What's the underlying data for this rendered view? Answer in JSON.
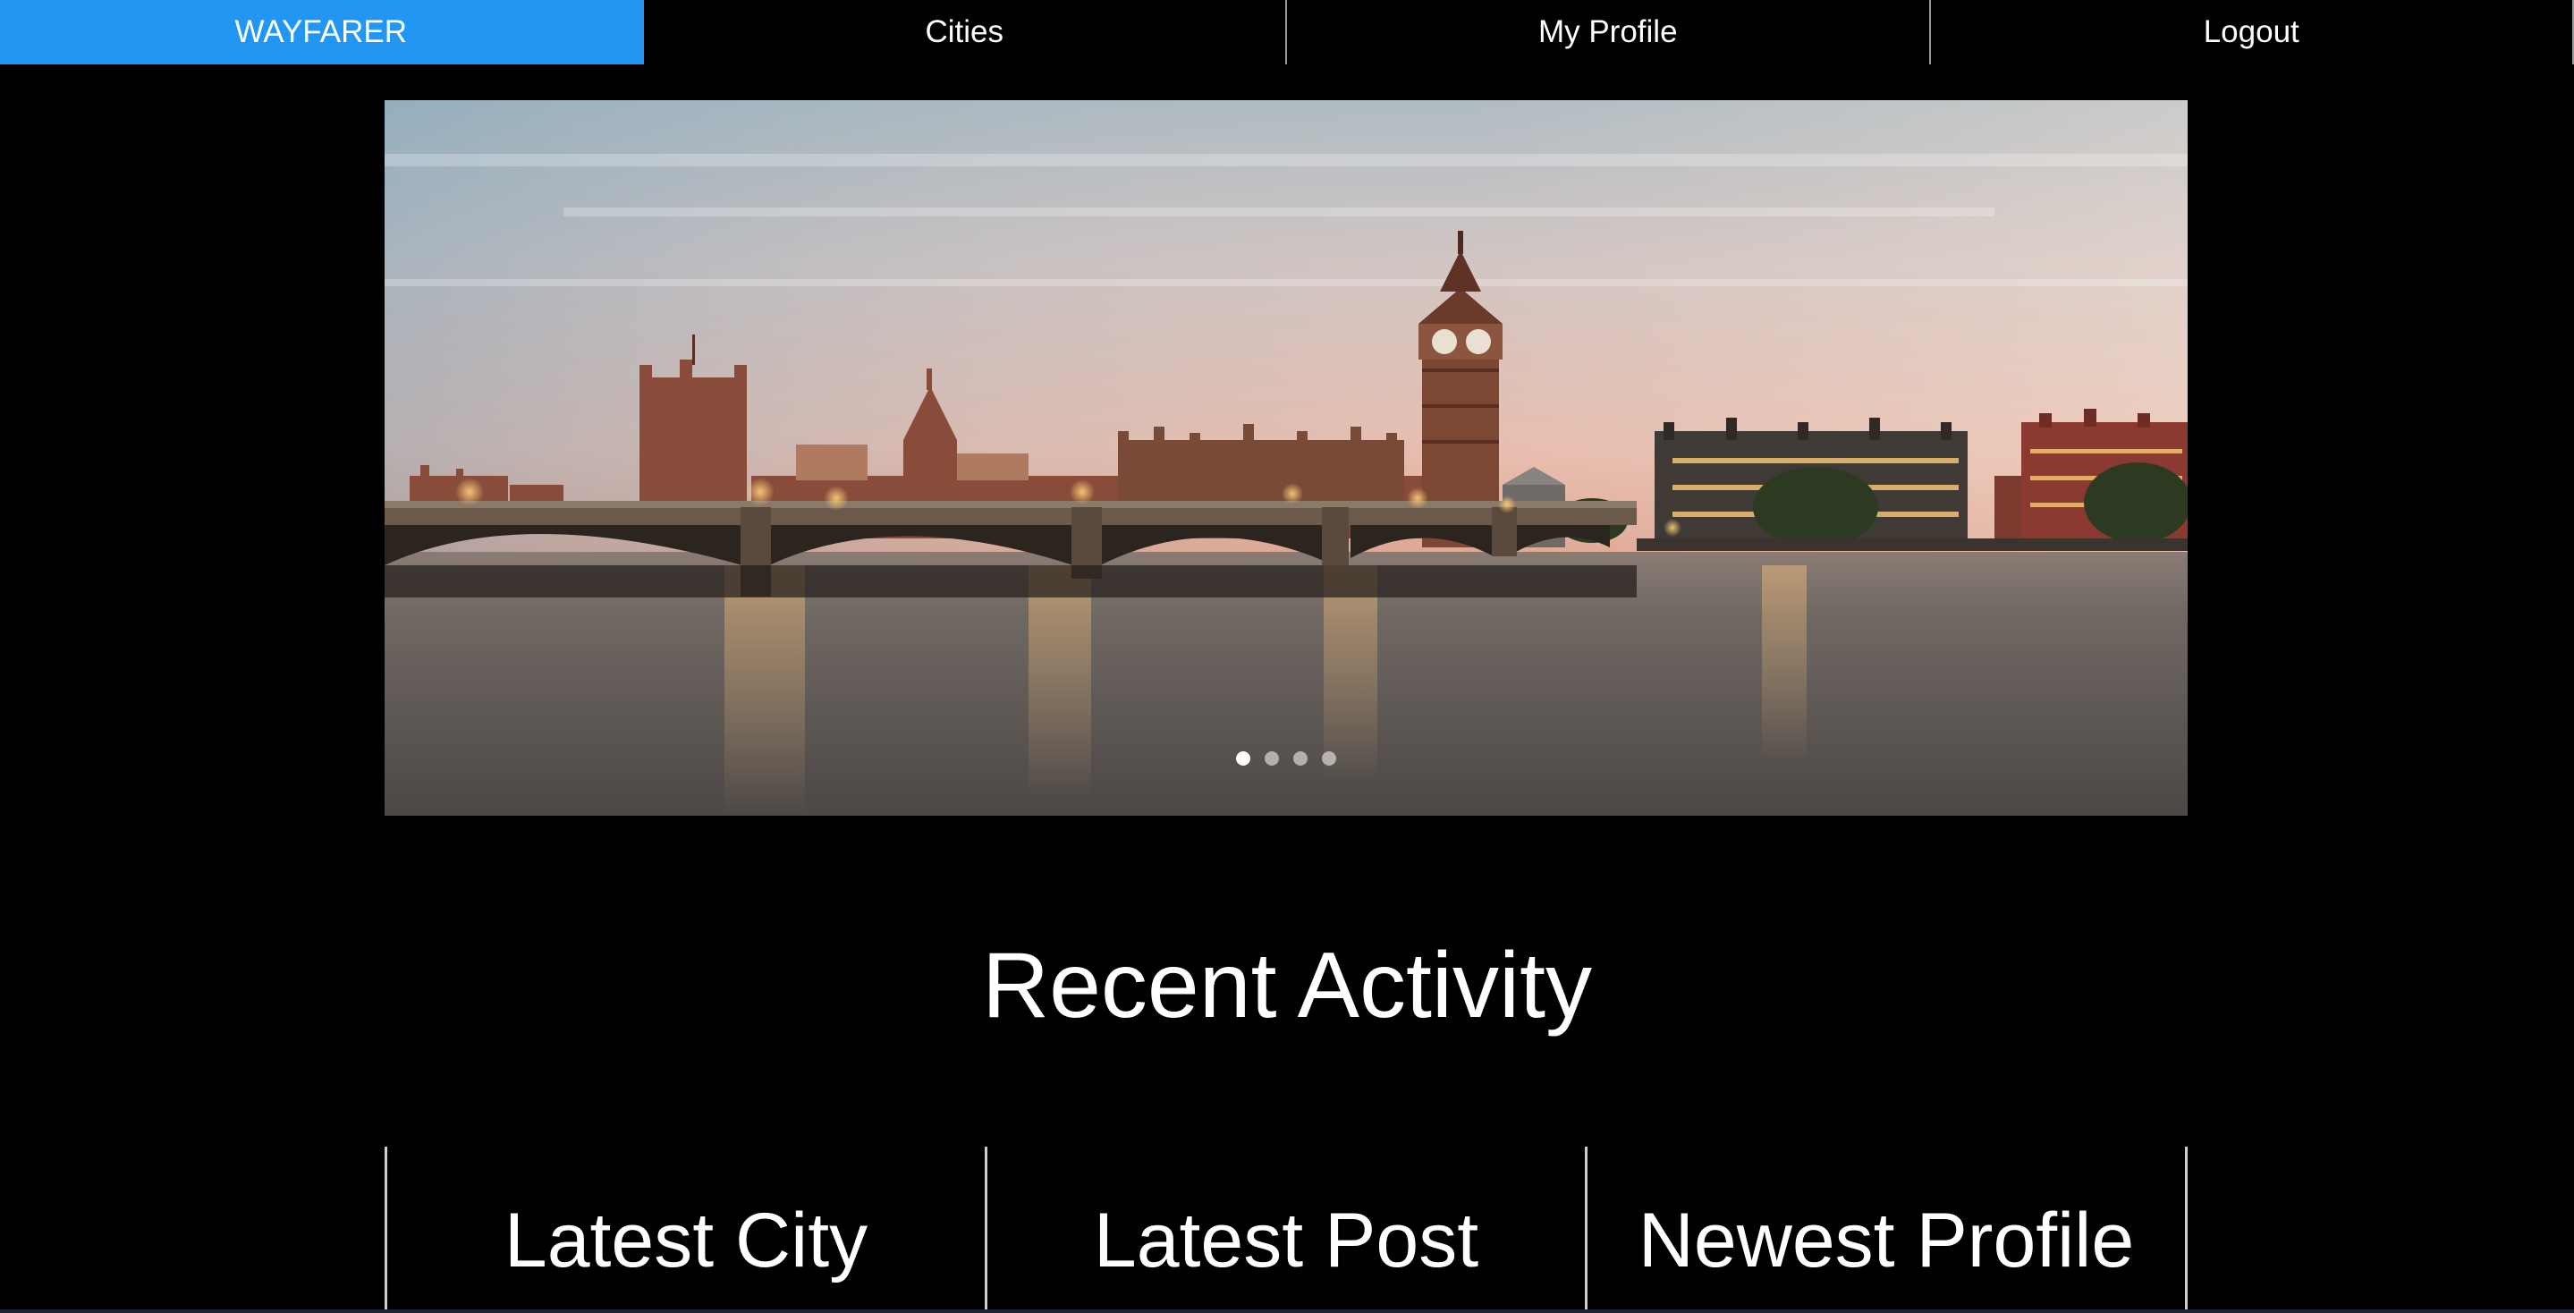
{
  "nav": {
    "items": [
      {
        "label": "WAYFARER",
        "active": true
      },
      {
        "label": "Cities",
        "active": false
      },
      {
        "label": "My Profile",
        "active": false
      },
      {
        "label": "Logout",
        "active": false
      }
    ]
  },
  "hero": {
    "image": "london-skyline-westminster",
    "slide_count": 4,
    "active_slide": 1
  },
  "recent_activity": {
    "title": "Recent Activity",
    "columns": [
      {
        "title": "Latest City"
      },
      {
        "title": "Latest Post"
      },
      {
        "title": "Newest Profile"
      }
    ]
  },
  "colors": {
    "nav_active": "#2196f3",
    "background": "#000000",
    "text": "#ffffff"
  }
}
